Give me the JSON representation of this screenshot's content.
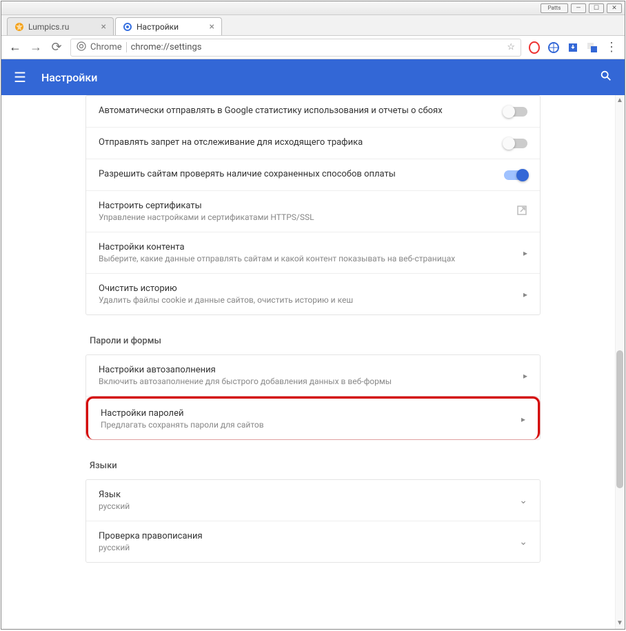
{
  "window": {
    "badge": "Patts"
  },
  "tabs": [
    {
      "title": "Lumpics.ru",
      "active": false,
      "icon": "orange"
    },
    {
      "title": "Настройки",
      "active": true,
      "icon": "gear"
    }
  ],
  "omnibox": {
    "prefix": "Chrome",
    "url": "chrome://settings"
  },
  "header": {
    "title": "Настройки"
  },
  "privacy_rows": [
    {
      "title": "Автоматически отправлять в Google статистику использования и отчеты о сбоях",
      "sub": "",
      "action": "toggle",
      "on": false
    },
    {
      "title": "Отправлять запрет на отслеживание для исходящего трафика",
      "sub": "",
      "action": "toggle",
      "on": false
    },
    {
      "title": "Разрешить сайтам проверять наличие сохраненных способов оплаты",
      "sub": "",
      "action": "toggle",
      "on": true
    },
    {
      "title": "Настроить сертификаты",
      "sub": "Управление настройками и сертификатами HTTPS/SSL",
      "action": "extlink"
    },
    {
      "title": "Настройки контента",
      "sub": "Выберите, какие данные отправлять сайтам и какой контент показывать на веб-страницах",
      "action": "arrow"
    },
    {
      "title": "Очистить историю",
      "sub": "Удалить файлы cookie и данные сайтов, очистить историю и кеш",
      "action": "arrow"
    }
  ],
  "sections": {
    "passwords_forms": {
      "heading": "Пароли и формы",
      "rows": [
        {
          "title": "Настройки автозаполнения",
          "sub": "Включить автозаполнение для быстрого добавления данных в веб-формы",
          "action": "arrow",
          "highlight": false
        },
        {
          "title": "Настройки паролей",
          "sub": "Предлагать сохранять пароли для сайтов",
          "action": "arrow",
          "highlight": true
        }
      ]
    },
    "languages": {
      "heading": "Языки",
      "rows": [
        {
          "title": "Язык",
          "sub": "русский",
          "action": "chevron"
        },
        {
          "title": "Проверка правописания",
          "sub": "русский",
          "action": "chevron"
        }
      ]
    }
  }
}
